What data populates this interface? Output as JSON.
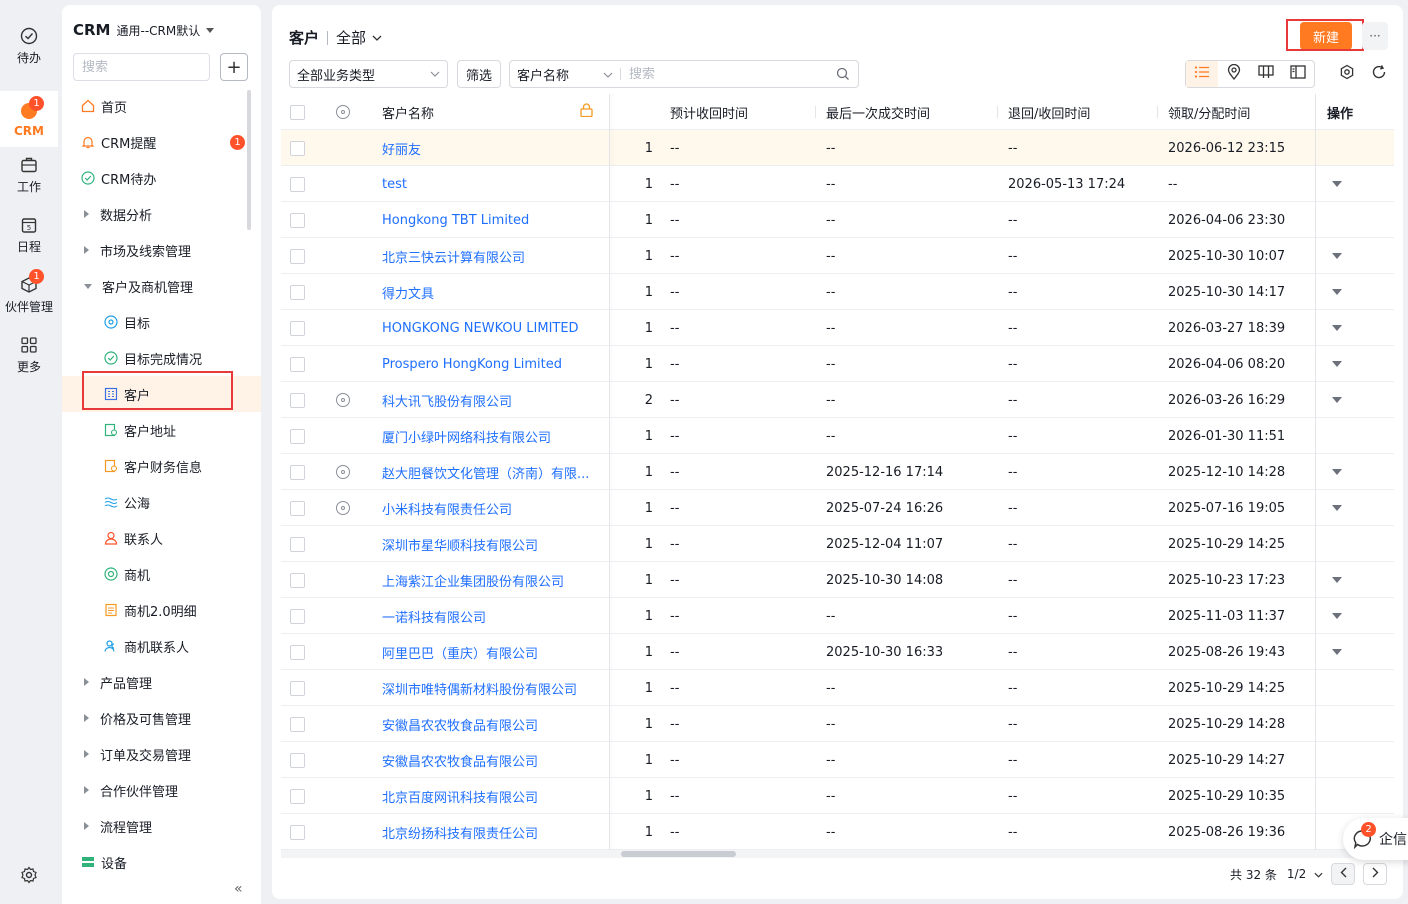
{
  "rail": {
    "items": [
      {
        "label": "待办",
        "icon": "todo-icon"
      },
      {
        "label": "CRM",
        "icon": "crm-icon",
        "badge": "1"
      },
      {
        "label": "工作",
        "icon": "briefcase-icon"
      },
      {
        "label": "日程",
        "icon": "calendar-icon",
        "day": "5"
      },
      {
        "label": "伙伴管理",
        "icon": "partner-icon",
        "badge": "1"
      },
      {
        "label": "更多",
        "icon": "grid-icon"
      }
    ]
  },
  "sidebar": {
    "app_name": "CRM",
    "app_sub": "通用--CRM默认",
    "search_placeholder": "搜索",
    "add_label": "+",
    "items": [
      {
        "label": "首页",
        "icon": "home-icon"
      },
      {
        "label": "CRM提醒",
        "icon": "bell-icon",
        "badge": "1"
      },
      {
        "label": "CRM待办",
        "icon": "check-circle-icon"
      },
      {
        "label": "数据分析"
      },
      {
        "label": "市场及线索管理"
      },
      {
        "label": "客户及商机管理"
      },
      {
        "label": "目标",
        "icon": "target-icon"
      },
      {
        "label": "目标完成情况",
        "icon": "check-circle-icon"
      },
      {
        "label": "客户",
        "icon": "building-icon"
      },
      {
        "label": "客户地址",
        "icon": "address-icon"
      },
      {
        "label": "客户财务信息",
        "icon": "finance-icon"
      },
      {
        "label": "公海",
        "icon": "wave-icon"
      },
      {
        "label": "联系人",
        "icon": "person-icon"
      },
      {
        "label": "商机",
        "icon": "opportunity-icon"
      },
      {
        "label": "商机2.0明细",
        "icon": "document-icon"
      },
      {
        "label": "商机联系人",
        "icon": "contacts-icon"
      },
      {
        "label": "产品管理"
      },
      {
        "label": "价格及可售管理"
      },
      {
        "label": "订单及交易管理"
      },
      {
        "label": "合作伙伴管理"
      },
      {
        "label": "流程管理"
      },
      {
        "label": "设备",
        "icon": "device-icon"
      }
    ],
    "collapse_label": "«"
  },
  "main": {
    "title": "客户",
    "view": "全部",
    "new_label": "新建",
    "more_label": "···",
    "biz_type": "全部业务类型",
    "filter_label": "筛选",
    "search_field": "客户名称",
    "search_placeholder": "搜索",
    "columns": {
      "name": "客户名称",
      "d1": "预计收回时间",
      "d2": "最后一次成交时间",
      "d3": "退回/收回时间",
      "d4": "领取/分配时间",
      "op": "操作"
    },
    "rows": [
      {
        "name": "好丽友",
        "num": "1",
        "d1": "--",
        "d2": "--",
        "d3": "--",
        "d4": "2026-06-12 23:15",
        "icon": false,
        "op": false
      },
      {
        "name": "test",
        "num": "1",
        "d1": "--",
        "d2": "--",
        "d3": "2026-05-13 17:24",
        "d4": "--",
        "icon": false,
        "op": true
      },
      {
        "name": "Hongkong TBT Limited",
        "num": "1",
        "d1": "--",
        "d2": "--",
        "d3": "--",
        "d4": "2026-04-06 23:30",
        "icon": false,
        "op": false
      },
      {
        "name": "北京三快云计算有限公司",
        "num": "1",
        "d1": "--",
        "d2": "--",
        "d3": "--",
        "d4": "2025-10-30 10:07",
        "icon": false,
        "op": true
      },
      {
        "name": "得力文具",
        "num": "1",
        "d1": "--",
        "d2": "--",
        "d3": "--",
        "d4": "2025-10-30 14:17",
        "icon": false,
        "op": true
      },
      {
        "name": "HONGKONG NEWKOU LIMITED",
        "num": "1",
        "d1": "--",
        "d2": "--",
        "d3": "--",
        "d4": "2026-03-27 18:39",
        "icon": false,
        "op": true
      },
      {
        "name": "Prospero HongKong Limited",
        "num": "1",
        "d1": "--",
        "d2": "--",
        "d3": "--",
        "d4": "2026-04-06 08:20",
        "icon": false,
        "op": true
      },
      {
        "name": "科大讯飞股份有限公司",
        "num": "2",
        "d1": "--",
        "d2": "--",
        "d3": "--",
        "d4": "2026-03-26 16:29",
        "icon": true,
        "op": true
      },
      {
        "name": "厦门小绿叶网络科技有限公司",
        "num": "1",
        "d1": "--",
        "d2": "--",
        "d3": "--",
        "d4": "2026-01-30 11:51",
        "icon": false,
        "op": false
      },
      {
        "name": "赵大胆餐饮文化管理（济南）有限...",
        "num": "1",
        "d1": "--",
        "d2": "2025-12-16 17:14",
        "d3": "--",
        "d4": "2025-12-10 14:28",
        "icon": true,
        "op": true
      },
      {
        "name": "小米科技有限责任公司",
        "num": "1",
        "d1": "--",
        "d2": "2025-07-24 16:26",
        "d3": "--",
        "d4": "2025-07-16 19:05",
        "icon": true,
        "op": true
      },
      {
        "name": "深圳市星华顺科技有限公司",
        "num": "1",
        "d1": "--",
        "d2": "2025-12-04 11:07",
        "d3": "--",
        "d4": "2025-10-29 14:25",
        "icon": false,
        "op": false
      },
      {
        "name": "上海紫江企业集团股份有限公司",
        "num": "1",
        "d1": "--",
        "d2": "2025-10-30 14:08",
        "d3": "--",
        "d4": "2025-10-23 17:23",
        "icon": false,
        "op": true
      },
      {
        "name": "一诺科技有限公司",
        "num": "1",
        "d1": "--",
        "d2": "--",
        "d3": "--",
        "d4": "2025-11-03 11:37",
        "icon": false,
        "op": true
      },
      {
        "name": "阿里巴巴（重庆）有限公司",
        "num": "1",
        "d1": "--",
        "d2": "2025-10-30 16:33",
        "d3": "--",
        "d4": "2025-08-26 19:43",
        "icon": false,
        "op": true
      },
      {
        "name": "深圳市唯特偶新材料股份有限公司",
        "num": "1",
        "d1": "--",
        "d2": "--",
        "d3": "--",
        "d4": "2025-10-29 14:25",
        "icon": false,
        "op": false
      },
      {
        "name": "安徽昌农农牧食品有限公司",
        "num": "1",
        "d1": "--",
        "d2": "--",
        "d3": "--",
        "d4": "2025-10-29 14:28",
        "icon": false,
        "op": false
      },
      {
        "name": "安徽昌农农牧食品有限公司",
        "num": "1",
        "d1": "--",
        "d2": "--",
        "d3": "--",
        "d4": "2025-10-29 14:27",
        "icon": false,
        "op": false
      },
      {
        "name": "北京百度网讯科技有限公司",
        "num": "1",
        "d1": "--",
        "d2": "--",
        "d3": "--",
        "d4": "2025-10-29 10:35",
        "icon": false,
        "op": false
      },
      {
        "name": "北京纷扬科技有限责任公司",
        "num": "1",
        "d1": "--",
        "d2": "--",
        "d3": "--",
        "d4": "2025-08-26 19:36",
        "icon": false,
        "op": false
      }
    ],
    "pager": {
      "total": "共 32 条",
      "page": "1/2"
    }
  },
  "qixin": {
    "label": "企信",
    "badge": "2"
  },
  "colors": {
    "accent": "#ff7a20",
    "link": "#1f6fff",
    "badge": "#ff522a",
    "highlight": "#e8393a"
  }
}
